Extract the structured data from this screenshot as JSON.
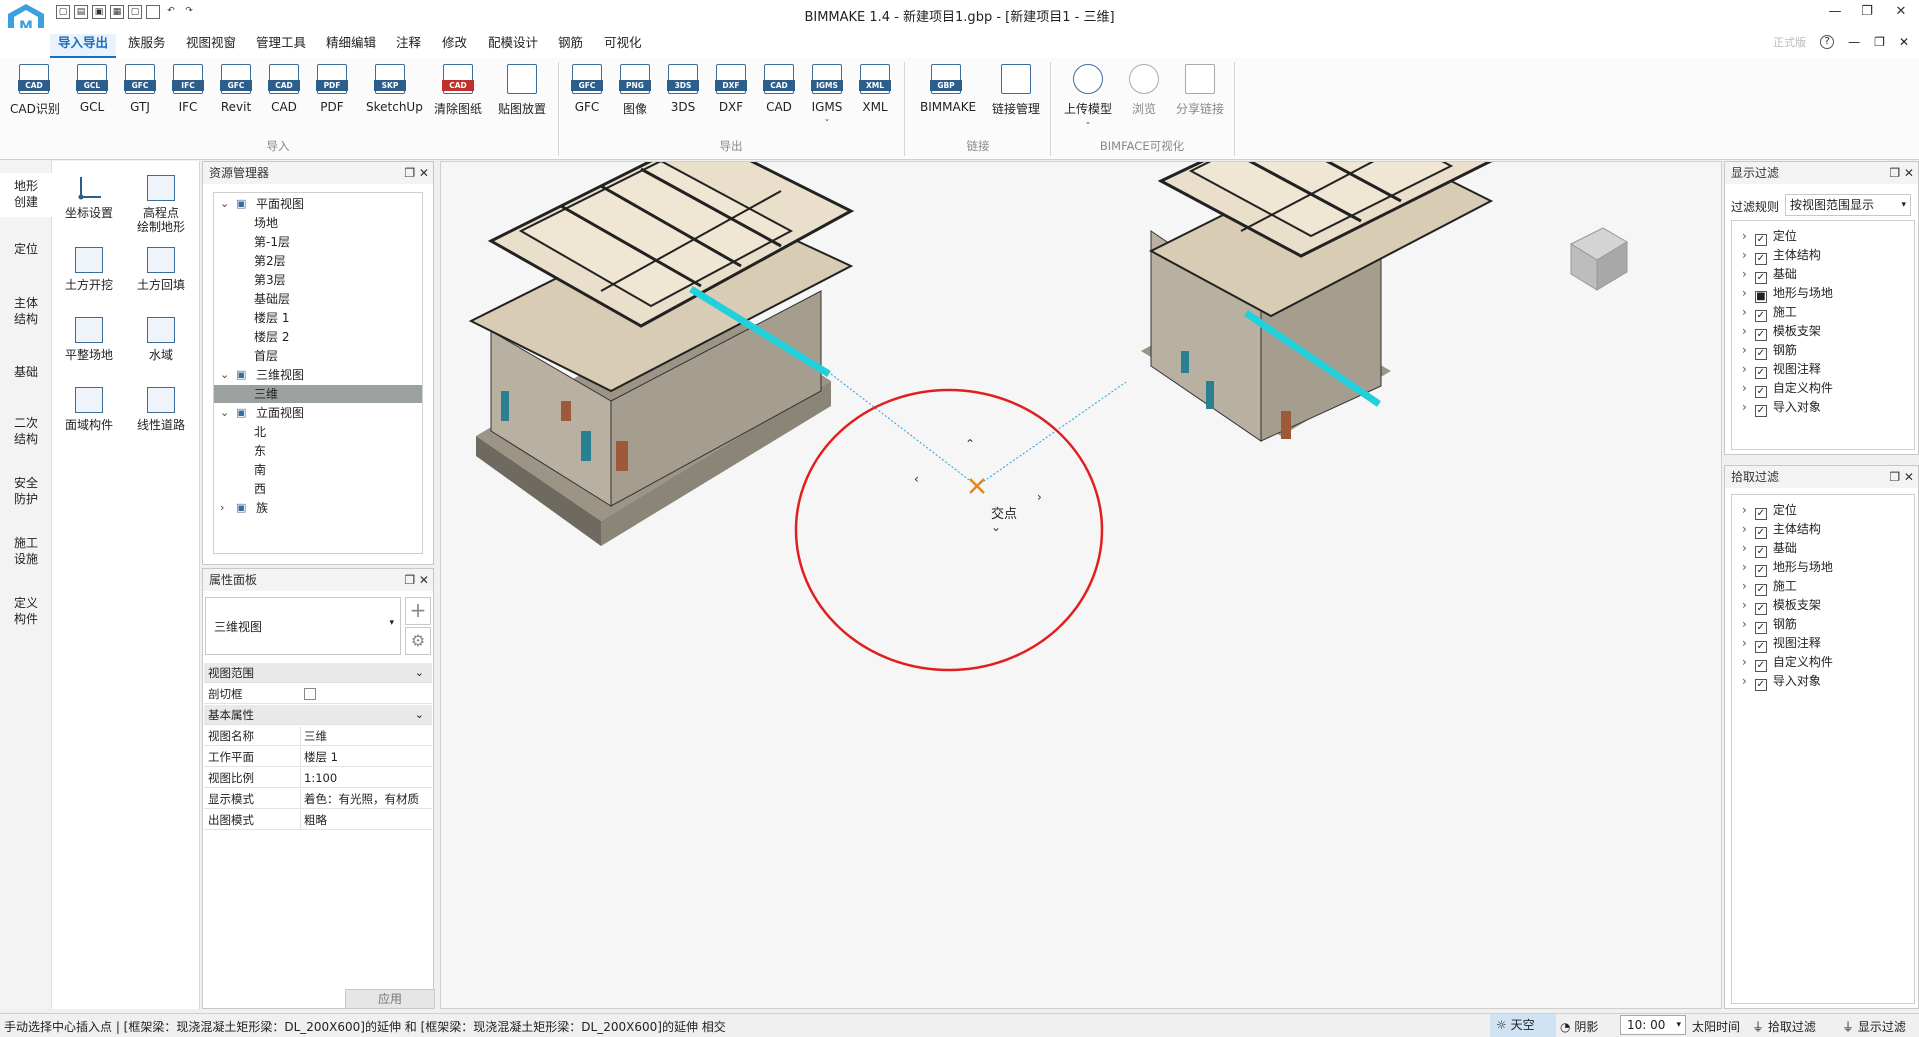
{
  "window": {
    "title": "BIMMAKE 1.4 - 新建项目1.gbp - [新建项目1 - 三维]"
  },
  "tabs": [
    "导入导出",
    "族服务",
    "视图视窗",
    "管理工具",
    "精细编辑",
    "注释",
    "修改",
    "配模设计",
    "钢筋",
    "可视化"
  ],
  "tabs_right": {
    "edition": "正式版",
    "help": "?"
  },
  "ribbon": {
    "import_group": "导入",
    "export_group": "导出",
    "link_group": "链接",
    "bimface_group": "BIMFACE可视化",
    "import_buttons": [
      {
        "label": "CAD识别",
        "tag": "CAD"
      },
      {
        "label": "GCL",
        "tag": "GCL"
      },
      {
        "label": "GTJ",
        "tag": "GFC"
      },
      {
        "label": "IFC",
        "tag": "IFC"
      },
      {
        "label": "Revit",
        "tag": "GFC"
      },
      {
        "label": "CAD",
        "tag": "CAD"
      },
      {
        "label": "PDF",
        "tag": "PDF"
      },
      {
        "label": "SketchUp",
        "tag": "SKP"
      },
      {
        "label": "清除图纸",
        "tag": "CAD"
      },
      {
        "label": "贴图放置",
        "tag": ""
      }
    ],
    "export_buttons": [
      {
        "label": "GFC",
        "tag": "GFC"
      },
      {
        "label": "图像",
        "tag": "PNG"
      },
      {
        "label": "3DS",
        "tag": "3DS"
      },
      {
        "label": "DXF",
        "tag": "DXF"
      },
      {
        "label": "CAD",
        "tag": "CAD"
      },
      {
        "label": "IGMS",
        "tag": "IGMS"
      },
      {
        "label": "XML",
        "tag": "XML"
      }
    ],
    "link_buttons": [
      {
        "label": "BIMMAKE",
        "tag": "GBP"
      },
      {
        "label": "链接管理",
        "tag": ""
      }
    ],
    "bimface_buttons": [
      {
        "label": "上传模型"
      },
      {
        "label": "浏览"
      },
      {
        "label": "分享链接"
      }
    ]
  },
  "left_nav": [
    "地形\n创建",
    "定位",
    "主体\n结构",
    "基础",
    "二次\n结构",
    "安全\n防护",
    "施工\n设施",
    "定义\n构件"
  ],
  "tools": [
    "坐标设置",
    "高程点\n绘制地形",
    "土方开挖",
    "土方回填",
    "平整场地",
    "水域",
    "面域构件",
    "线性道路"
  ],
  "resource_manager": {
    "title": "资源管理器",
    "items": [
      {
        "label": "平面视图",
        "level": 0
      },
      {
        "label": "场地",
        "level": 1
      },
      {
        "label": "第-1层",
        "level": 1
      },
      {
        "label": "第2层",
        "level": 1
      },
      {
        "label": "第3层",
        "level": 1
      },
      {
        "label": "基础层",
        "level": 1
      },
      {
        "label": "楼层 1",
        "level": 1
      },
      {
        "label": "楼层 2",
        "level": 1
      },
      {
        "label": "首层",
        "level": 1
      },
      {
        "label": "三维视图",
        "level": 0
      },
      {
        "label": "三维",
        "level": 1
      },
      {
        "label": "立面视图",
        "level": 0
      },
      {
        "label": "北",
        "level": 1
      },
      {
        "label": "东",
        "level": 1
      },
      {
        "label": "南",
        "level": 1
      },
      {
        "label": "西",
        "level": 1
      },
      {
        "label": "族",
        "level": 0
      }
    ]
  },
  "properties": {
    "title": "属性面板",
    "type_value": "三维视图",
    "rows": [
      {
        "k": "视图范围",
        "v": "",
        "cat": true
      },
      {
        "k": "剖切框",
        "v": "",
        "cat": false
      },
      {
        "k": "基本属性",
        "v": "",
        "cat": true
      },
      {
        "k": "视图名称",
        "v": "三维",
        "cat": false
      },
      {
        "k": "工作平面",
        "v": "楼层 1",
        "cat": false
      },
      {
        "k": "视图比例",
        "v": "1:100",
        "cat": false
      },
      {
        "k": "显示模式",
        "v": "着色：有光照，有材质",
        "cat": false
      },
      {
        "k": "出图模式",
        "v": "粗略",
        "cat": false
      }
    ],
    "apply": "应用"
  },
  "viewport": {
    "snap_label": "交点"
  },
  "display_filter": {
    "title": "显示过滤",
    "rule_label": "过滤规则",
    "rule_value": "按视图范围显示",
    "items": [
      "定位",
      "主体结构",
      "基础",
      "地形与场地",
      "施工",
      "模板支架",
      "钢筋",
      "视图注释",
      "自定义构件",
      "导入对象"
    ]
  },
  "pick_filter": {
    "title": "拾取过滤",
    "items": [
      "定位",
      "主体结构",
      "基础",
      "地形与场地",
      "施工",
      "模板支架",
      "钢筋",
      "视图注释",
      "自定义构件",
      "导入对象"
    ]
  },
  "status": {
    "message": "手动选择中心插入点 | [框架梁：现浇混凝土矩形梁：DL_200X600]的延伸 和 [框架梁：现浇混凝土矩形梁：DL_200X600]的延伸 相交",
    "sky": "天空",
    "shadow": "阴影",
    "time": "10: 00",
    "sun_time": "太阳时间",
    "pick_filter": "拾取过滤",
    "display_filter": "显示过滤"
  },
  "colors": {
    "accent": "#1a6fc4",
    "highlight_beam": "#22d0dc",
    "circle": "#e02020",
    "snap": "#e08a1a"
  }
}
